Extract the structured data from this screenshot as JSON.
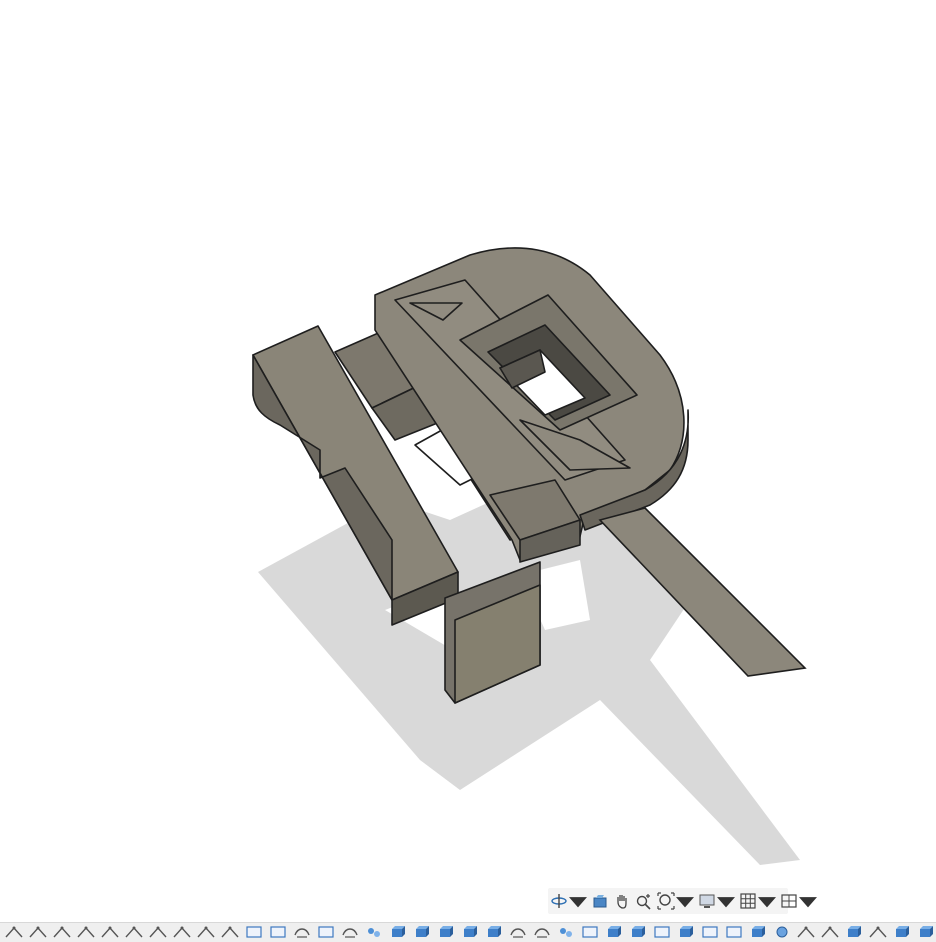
{
  "viewport": {
    "background": "#ffffff",
    "model_color": "#8c877b",
    "edge_color": "#1e1e1e",
    "shadow_color": "#cfcfcf"
  },
  "nav_toolbar": {
    "tools": [
      {
        "name": "orbit",
        "icon": "orbit-icon",
        "dropdown": true
      },
      {
        "name": "look-at",
        "icon": "look-at-icon",
        "dropdown": false
      },
      {
        "name": "pan",
        "icon": "pan-icon",
        "dropdown": false
      },
      {
        "name": "zoom",
        "icon": "zoom-icon",
        "dropdown": false
      },
      {
        "name": "fit",
        "icon": "fit-icon",
        "dropdown": true
      },
      {
        "name": "display-settings",
        "icon": "display-icon",
        "dropdown": true
      },
      {
        "name": "grid-settings",
        "icon": "grid-icon",
        "dropdown": true
      },
      {
        "name": "viewports",
        "icon": "viewports-icon",
        "dropdown": true
      }
    ]
  },
  "timeline": {
    "features": [
      "sketch",
      "sketch",
      "sketch",
      "sketch",
      "sketch",
      "sketch",
      "sketch",
      "sketch",
      "sketch",
      "sketch",
      "plane",
      "plane",
      "revolve",
      "plane",
      "revolve",
      "pattern",
      "extrude",
      "extrude",
      "extrude",
      "extrude",
      "extrude",
      "revolve",
      "revolve",
      "pattern",
      "plane",
      "extrude",
      "extrude",
      "plane",
      "extrude",
      "plane",
      "plane",
      "extrude",
      "body",
      "sketch",
      "sketch",
      "extrude",
      "sketch",
      "extrude",
      "extrude"
    ]
  }
}
